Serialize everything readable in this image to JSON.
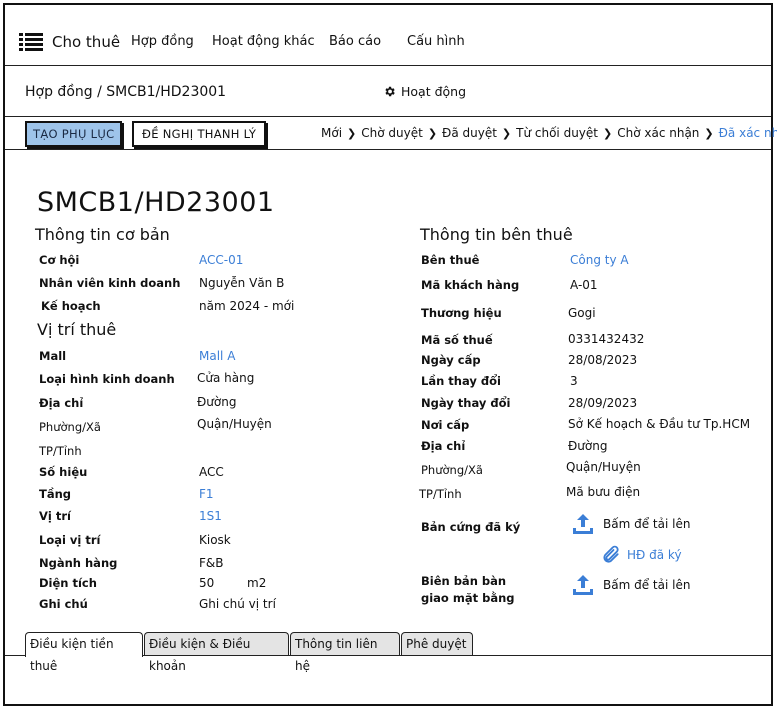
{
  "nav": {
    "brand": "Cho thuê",
    "items": [
      "Hợp đồng",
      "Hoạt động khác",
      "Báo cáo",
      "Cấu hình"
    ]
  },
  "breadcrumb": {
    "path": "Hợp đồng / SMCB1/HD23001",
    "activity": "Hoạt động"
  },
  "actions": {
    "add_appendix": "TẠO PHỤ LỤC",
    "request_liquidation": "ĐỀ NGHỊ THANH LÝ"
  },
  "status_steps": [
    "Mới",
    "Chờ duyệt",
    "Đã duyệt",
    "Từ chối duyệt",
    "Chờ xác nhận",
    "Đã xác nhận"
  ],
  "contract": {
    "code": "SMCB1/HD23001",
    "basic_title": "Thông tin cơ bản",
    "basic": {
      "opportunity_label": "Cơ hội",
      "opportunity": "ACC-01",
      "sales_label": "Nhân viên kinh doanh",
      "sales": "Nguyễn Văn B",
      "plan_label": "Kế hoạch",
      "plan": "năm 2024 - mới"
    },
    "location_title": "Vị trí thuê",
    "location": {
      "mall_label": "Mall",
      "mall": "Mall A",
      "type_label": "Loại hình kinh doanh",
      "type": "Cửa hàng",
      "address_label": "Địa chỉ",
      "address": "Đường",
      "ward_label": "Phường/Xã",
      "district": "Quận/Huyện",
      "city_label": "TP/Tỉnh",
      "number_label": "Số hiệu",
      "number": "ACC",
      "floor_label": "Tầng",
      "floor": "F1",
      "position_label": "Vị trí",
      "position": "1S1",
      "position_type_label": "Loại vị trí",
      "position_type": "Kiosk",
      "category_label": "Ngành hàng",
      "category": "F&B",
      "area_label": "Diện tích",
      "area": "50",
      "area_unit": "m2",
      "note_label": "Ghi chú",
      "note": "Ghi chú vị trí"
    },
    "tenant_title": "Thông tin bên thuê",
    "tenant": {
      "tenant_label": "Bên thuê",
      "tenant": "Công ty A",
      "customer_code_label": "Mã khách hàng",
      "customer_code": "A-01",
      "brand_label": "Thương hiệu",
      "brand": "Gogi",
      "tax_label": "Mã số thuế",
      "tax": "0331432432",
      "issue_date_label": "Ngày cấp",
      "issue_date": "28/08/2023",
      "change_count_label": "Lần thay đổi",
      "change_count": "3",
      "change_date_label": "Ngày thay đổi",
      "change_date": "28/09/2023",
      "issuer_label": "Nơi cấp",
      "issuer": "Sở Kế hoạch & Đầu tư Tp.HCM",
      "address_label": "Địa chỉ",
      "address": "Đường",
      "ward_label": "Phường/Xã",
      "district": "Quận/Huyện",
      "city_label": "TP/Tỉnh",
      "postal": "Mã bưu điện",
      "signed_copy_label": "Bản cứng đã ký",
      "upload_text": "Bấm để tải lên",
      "signed_file": "HĐ đã ký",
      "handover_label_1": "Biên bản bàn",
      "handover_label_2": "giao mặt bằng",
      "upload_text_2": "Bấm để tải lên"
    }
  },
  "tabs": [
    "Điều kiện tiền thuê",
    "Điều kiện & Điều khoản",
    "Thông tin liên hệ",
    "Phê duyệt"
  ],
  "colors": {
    "accent": "#3b7ed6",
    "primary_button": "#9ec4ea",
    "border": "#111111"
  }
}
